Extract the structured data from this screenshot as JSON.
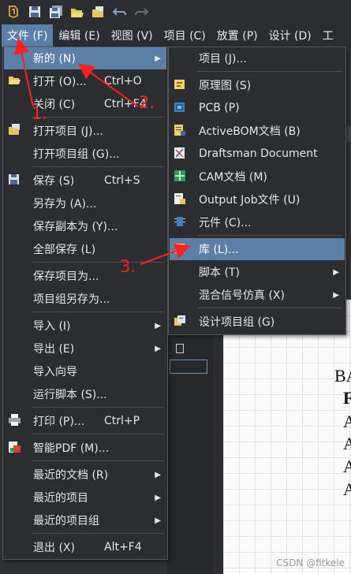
{
  "menubar": [
    "文件 (F)",
    "编辑 (E)",
    "视图 (V)",
    "项目 (C)",
    "放置 (P)",
    "设计 (D)",
    "工"
  ],
  "file_menu": [
    {
      "label": "新的 (N)",
      "arrow": true,
      "icon": ""
    },
    {
      "label": "打开 (O)...",
      "shortcut": "Ctrl+O",
      "icon": "open-folder-icon"
    },
    {
      "label": "关闭 (C)",
      "shortcut": "Ctrl+F4",
      "icon": ""
    },
    {
      "label": "打开项目 (J)...",
      "icon": "open-project-icon"
    },
    {
      "label": "打开项目组 (G)...",
      "icon": ""
    },
    {
      "label": "保存 (S)",
      "shortcut": "Ctrl+S",
      "icon": "save-icon"
    },
    {
      "label": "另存为 (A)...",
      "icon": ""
    },
    {
      "label": "保存副本为 (Y)...",
      "icon": ""
    },
    {
      "label": "全部保存 (L)",
      "icon": ""
    },
    {
      "label": "保存项目为...",
      "icon": ""
    },
    {
      "label": "项目组另存为...",
      "icon": ""
    },
    {
      "label": "导入 (I)",
      "arrow": true,
      "icon": ""
    },
    {
      "label": "导出 (E)",
      "arrow": true,
      "icon": ""
    },
    {
      "label": "导入向导",
      "icon": ""
    },
    {
      "label": "运行脚本 (S)...",
      "icon": ""
    },
    {
      "label": "打印 (P)...",
      "shortcut": "Ctrl+P",
      "icon": "print-icon"
    },
    {
      "label": "智能PDF (M)...",
      "icon": "smart-pdf-icon"
    },
    {
      "label": "最近的文档 (R)",
      "arrow": true,
      "icon": ""
    },
    {
      "label": "最近的项目",
      "arrow": true,
      "icon": ""
    },
    {
      "label": "最近的项目组",
      "arrow": true,
      "icon": ""
    },
    {
      "label": "退出 (X)",
      "shortcut": "Alt+F4",
      "icon": ""
    }
  ],
  "new_submenu": [
    {
      "label": "项目 (J)...",
      "icon": ""
    },
    {
      "label": "原理图 (S)",
      "icon": "schematic-icon"
    },
    {
      "label": "PCB (P)",
      "icon": "pcb-icon"
    },
    {
      "label": "ActiveBOM文档 (B)",
      "icon": "bom-icon"
    },
    {
      "label": "Draftsman Document",
      "icon": "draftsman-icon"
    },
    {
      "label": "CAM文档 (M)",
      "icon": "cam-icon"
    },
    {
      "label": "Output Job文件 (U)",
      "icon": "output-job-icon"
    },
    {
      "label": "元件 (C)...",
      "icon": "component-icon"
    },
    {
      "label": "库 (L)...",
      "icon": "library-icon"
    },
    {
      "label": "脚本 (T)",
      "arrow": true,
      "icon": ""
    },
    {
      "label": "混合信号仿真 (X)",
      "arrow": true,
      "icon": ""
    },
    {
      "label": "设计项目组 (G)",
      "icon": "design-group-icon"
    }
  ],
  "annotations": [
    "1.",
    "2.",
    "3."
  ],
  "document_text": [
    "BA",
    "F",
    "A",
    "A",
    "A",
    "A"
  ],
  "watermark": "CSDN @fitkele",
  "colors": {
    "highlight": "#5b7fa6",
    "menu_bg": "#2b2d30",
    "annotation": "#ff2020"
  }
}
